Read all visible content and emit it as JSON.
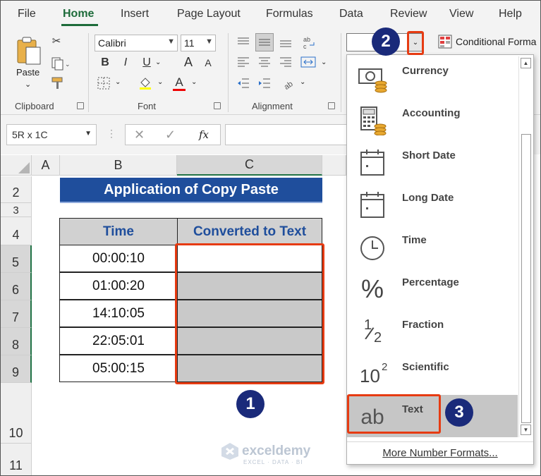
{
  "menu": {
    "tabs": [
      "File",
      "Home",
      "Insert",
      "Page Layout",
      "Formulas",
      "Data",
      "Review",
      "View",
      "Help"
    ],
    "active": "Home"
  },
  "ribbon": {
    "clipboard": {
      "paste_label": "Paste",
      "group_label": "Clipboard"
    },
    "font": {
      "font_name": "Calibri",
      "font_size": "11",
      "bold": "B",
      "italic": "I",
      "underline": "U",
      "grow": "A",
      "shrink": "A",
      "font_color_letter": "A",
      "group_label": "Font"
    },
    "alignment": {
      "group_label": "Alignment"
    },
    "number_format_value": "",
    "conditional_formatting": "Conditional Forma"
  },
  "formula_bar": {
    "name_box": "5R x 1C",
    "fx": "fx",
    "formula": ""
  },
  "grid": {
    "columns": [
      "A",
      "B",
      "C"
    ],
    "rows": [
      "2",
      "3",
      "4",
      "5",
      "6",
      "7",
      "8",
      "9",
      "10",
      "11"
    ],
    "title": "Application of Copy Paste",
    "table": {
      "headers": [
        "Time",
        "Converted to Text"
      ],
      "rows": [
        [
          "00:00:10",
          ""
        ],
        [
          "01:00:20",
          ""
        ],
        [
          "14:10:05",
          ""
        ],
        [
          "22:05:01",
          ""
        ],
        [
          "05:00:15",
          ""
        ]
      ]
    }
  },
  "number_format_menu": {
    "items": [
      {
        "label": "Currency",
        "icon": "currency-icon"
      },
      {
        "label": "Accounting",
        "icon": "accounting-icon"
      },
      {
        "label": "Short Date",
        "icon": "calendar-icon"
      },
      {
        "label": "Long Date",
        "icon": "calendar-icon"
      },
      {
        "label": "Time",
        "icon": "clock-icon"
      },
      {
        "label": "Percentage",
        "icon": "percent-icon"
      },
      {
        "label": "Fraction",
        "icon": "fraction-icon"
      },
      {
        "label": "Scientific",
        "icon": "scientific-icon"
      },
      {
        "label": "Text",
        "icon": "text-ab-icon"
      }
    ],
    "highlighted": "Text",
    "more_label": "More Number Formats...",
    "fraction_glyph_top": "1",
    "fraction_glyph_bottom": "2",
    "percent_glyph": "%",
    "scientific_glyph": "10",
    "scientific_exp": "2",
    "text_glyph": "ab"
  },
  "annotations": {
    "step1": "1",
    "step2": "2",
    "step3": "3"
  },
  "watermark": {
    "name": "exceldemy",
    "tagline": "EXCEL · DATA · BI"
  },
  "colors": {
    "accent": "#217346",
    "title_bg": "#1f4e9c",
    "step_badge": "#1a2a7a",
    "highlight_box": "#e63b12"
  }
}
